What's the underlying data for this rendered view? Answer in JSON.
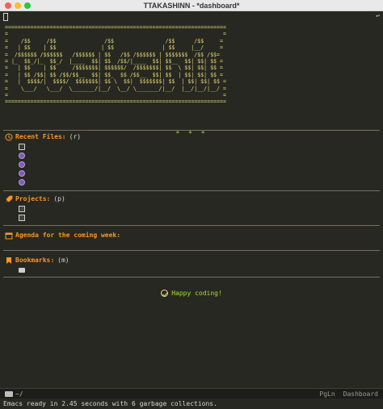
{
  "window": {
    "title": "TTAKASHINN - *dashboard*"
  },
  "banner": {
    "art": "=====================================================================\n=                                                                   =\n=    /$$     /$$               /$$                /$$      /$$     =\n=   | $$    | $$              | $$               | $$     |__/     =\n=  /$$$$$$ /$$$$$$   /$$$$$$ | $$   /$$ /$$$$$$ | $$$$$$$  /$$ /$$=\n= |_  $$_/|_  $$_/  |____  $$| $$  /$$/|____  $$| $$__  $$| $$| $$ =\n=   | $$    | $$     /$$$$$$$| $$$$$$/  /$$$$$$$| $$  \\ $$| $$| $$ =\n=   | $$ /$$| $$ /$$/$$__  $$| $$_  $$ /$$__  $$| $$  | $$| $$| $$ =\n=   |  $$$$/|  $$$$/  $$$$$$$| $$ \\  $$|  $$$$$$$| $$  | $$| $$| $$ =\n=    \\___/   \\___/  \\_______/|__/  \\__/ \\_______/|__/  |__/|__/|__/ =\n=                                                                   =\n=====================================================================",
    "stars": "* * *"
  },
  "sections": {
    "recent": {
      "title": "Recent Files:",
      "key": "(r)"
    },
    "projects": {
      "title": "Projects:",
      "key": "(p)"
    },
    "agenda": {
      "title": "Agenda for the coming week:"
    },
    "bookmarks": {
      "title": "Bookmarks:",
      "key": "(m)"
    }
  },
  "footer": {
    "message": "Happy coding!"
  },
  "modeline": {
    "path": "~/",
    "position": "PgLn",
    "mode": "Dashboard"
  },
  "echo": {
    "message": "Emacs ready in 2.45 seconds with 6 garbage collections."
  },
  "colors": {
    "background": "#272822",
    "heading": "#fd971f",
    "banner": "#e6db74",
    "accent": "#a6e22e"
  }
}
